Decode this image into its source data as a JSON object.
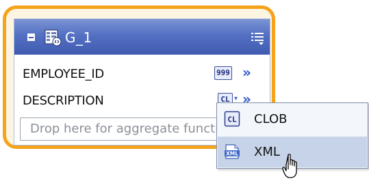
{
  "group": {
    "title": "G_1",
    "fields": [
      {
        "name": "EMPLOYEE_ID",
        "type_badge": "999"
      },
      {
        "name": "DESCRIPTION",
        "type_badge": "CL"
      }
    ],
    "arrow_glyph": "»",
    "dropdown_glyph": "▾",
    "drop_placeholder": "Drop here for aggregate functions"
  },
  "type_menu": {
    "items": [
      {
        "badge": "CL",
        "label": "CLOB",
        "icon": "clob-icon"
      },
      {
        "badge": "XML",
        "label": "XML",
        "icon": "xml-icon",
        "hovered": true
      }
    ]
  },
  "colors": {
    "group_border": "#f4a31a",
    "header_blue": "#4a65bb",
    "arrow_blue": "#2a56c8",
    "menu_hover": "#c7d3e8"
  }
}
